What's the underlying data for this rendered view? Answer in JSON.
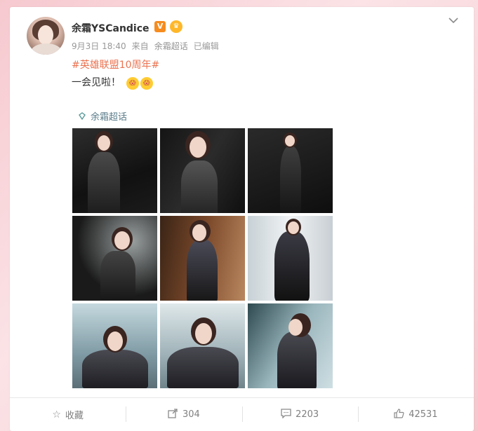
{
  "post": {
    "author": "余霜YSCandice",
    "verified_badge": "V",
    "time": "9月3日 18:40",
    "source_prefix": "来自",
    "source": "余霜超话",
    "edited": "已编辑",
    "topic": "#英雄联盟10周年#",
    "text": "一会见啦！",
    "super_topic": "余霜超话"
  },
  "actions": {
    "collect": "收藏",
    "repost": "304",
    "comment": "2203",
    "like": "42531"
  },
  "icons": {
    "more": "chevron-down-icon",
    "collect": "star-icon",
    "repost": "share-icon",
    "comment": "comment-icon",
    "like": "thumbs-up-icon"
  },
  "colors": {
    "topic": "#eb7350",
    "username": "#333333",
    "muted": "#999999"
  }
}
